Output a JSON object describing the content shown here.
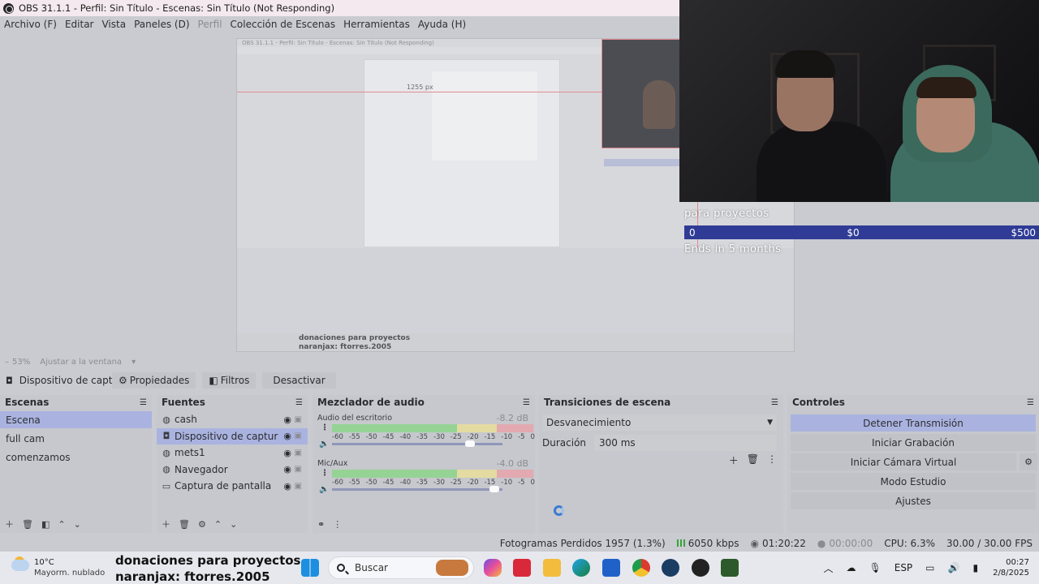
{
  "window": {
    "title": "OBS 31.1.1 - Perfil: Sin Título - Escenas: Sin Título (Not Responding)"
  },
  "menu": [
    "Archivo (F)",
    "Editar",
    "Vista",
    "Paneles (D)",
    "Perfil",
    "Colección de Escenas",
    "Herramientas",
    "Ayuda (H)"
  ],
  "preview": {
    "nested_title": "OBS 31.1.1 - Perfil: Sin Título - Escenas: Sin Título (Not Responding)",
    "px_label": "1255 px",
    "nested_donation_line1": "donaciones para proyectos",
    "nested_donation_line2": "naranjax: ftorres.2005"
  },
  "goal": {
    "label": "para proyectos",
    "start": "0",
    "current": "$0",
    "target": "$500",
    "ends": "Ends in 5 months"
  },
  "zoom": {
    "percent": "53%",
    "fit": "Ajustar a la ventana"
  },
  "source_toolbar": {
    "source_name": "Dispositivo de captura",
    "properties": "Propiedades",
    "filters": "Filtros",
    "deactivate": "Desactivar"
  },
  "scenes": {
    "title": "Escenas",
    "items": [
      "Escena",
      "full cam",
      "comenzamos"
    ]
  },
  "sources": {
    "title": "Fuentes",
    "items": [
      {
        "label": "cash",
        "icon": "globe-icon"
      },
      {
        "label": "Dispositivo de captura de video",
        "icon": "camera-icon"
      },
      {
        "label": "mets1",
        "icon": "globe-icon"
      },
      {
        "label": "Navegador",
        "icon": "globe-icon"
      },
      {
        "label": "Captura de pantalla",
        "icon": "monitor-icon"
      }
    ]
  },
  "mixer": {
    "title": "Mezclador de audio",
    "channels": [
      {
        "name": "Audio del escritorio",
        "db": "-8.2 dB"
      },
      {
        "name": "Mic/Aux",
        "db": "-4.0 dB"
      }
    ],
    "scale": [
      "-60",
      "-55",
      "-50",
      "-45",
      "-40",
      "-35",
      "-30",
      "-25",
      "-20",
      "-15",
      "-10",
      "-5",
      "0"
    ]
  },
  "transitions": {
    "title": "Transiciones de escena",
    "selected": "Desvanecimiento",
    "duration_label": "Duración",
    "duration_value": "300 ms"
  },
  "controls": {
    "title": "Controles",
    "buttons": [
      "Detener Transmisión",
      "Iniciar Grabación",
      "Iniciar Cámara Virtual",
      "Modo Estudio",
      "Ajustes"
    ]
  },
  "status": {
    "dropped": "Fotogramas Perdidos 1957 (1.3%)",
    "bitrate": "6050 kbps",
    "stream_time": "01:20:22",
    "rec_time": "00:00:00",
    "cpu": "CPU: 6.3%",
    "fps": "30.00 / 30.00 FPS"
  },
  "taskbar": {
    "temp": "10°C",
    "condition": "Mayorm. nublado",
    "donation_line1": "donaciones para proyectos",
    "donation_line2": "naranjax: ftorres.2005",
    "search": "Buscar",
    "lang": "ESP",
    "time": "00:27",
    "date": "2/8/2025"
  }
}
